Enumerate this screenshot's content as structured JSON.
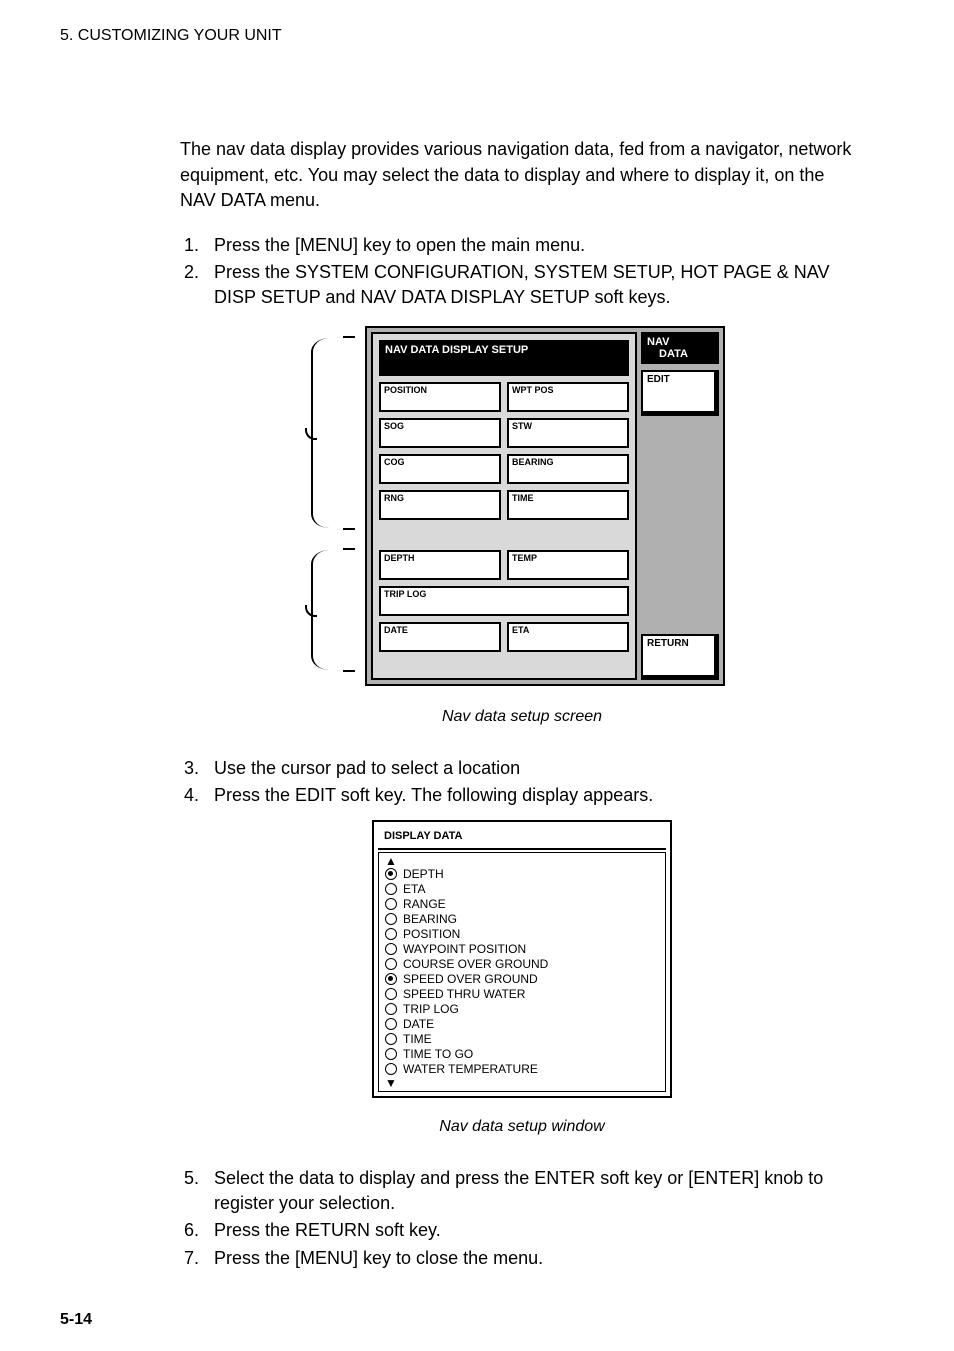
{
  "page": {
    "running_head": "5. CUSTOMIZING YOUR UNIT",
    "page_number": "5-14"
  },
  "intro": "The nav data display provides various navigation data, fed from a navigator, network equipment, etc. You may select the data to display and where to display it, on the NAV DATA menu.",
  "steps_1": [
    "Press the [MENU] key to open the main menu.",
    "Press the SYSTEM CONFIGURATION, SYSTEM SETUP, HOT PAGE & NAV DISP SETUP and NAV DATA DISPLAY SETUP soft keys."
  ],
  "fig1": {
    "side": {
      "title_l1": "NAV",
      "title_l2": "DATA",
      "btn1": "EDIT",
      "btn2": "RETURN"
    },
    "header": "NAV DATA DISPLAY SETUP",
    "cells_top": [
      [
        "POSITION",
        "WPT POS"
      ],
      [
        "SOG",
        "STW"
      ],
      [
        "COG",
        "BEARING"
      ],
      [
        "RNG",
        "TIME"
      ]
    ],
    "cells_bottom": [
      [
        "DEPTH",
        "TEMP"
      ],
      [
        "TRIP LOG",
        ""
      ],
      [
        "DATE",
        "ETA"
      ]
    ],
    "caption": "Nav data setup screen"
  },
  "steps_2": [
    "Use the cursor pad to select a location",
    "Press the EDIT soft key. The following display appears."
  ],
  "fig2": {
    "title": "DISPLAY DATA",
    "items": [
      {
        "label": "DEPTH",
        "sel": true
      },
      {
        "label": "ETA",
        "sel": false
      },
      {
        "label": "RANGE",
        "sel": false
      },
      {
        "label": "BEARING",
        "sel": false
      },
      {
        "label": "POSITION",
        "sel": false
      },
      {
        "label": "WAYPOINT POSITION",
        "sel": false
      },
      {
        "label": "COURSE OVER GROUND",
        "sel": false
      },
      {
        "label": "SPEED OVER GROUND",
        "sel": true
      },
      {
        "label": "SPEED THRU WATER",
        "sel": false
      },
      {
        "label": "TRIP LOG",
        "sel": false
      },
      {
        "label": "DATE",
        "sel": false
      },
      {
        "label": "TIME",
        "sel": false
      },
      {
        "label": "TIME TO GO",
        "sel": false
      },
      {
        "label": "WATER TEMPERATURE",
        "sel": false
      }
    ],
    "caption": "Nav data setup window"
  },
  "steps_3": [
    "Select the data to display and press the ENTER soft key or [ENTER] knob to register your selection.",
    "Press the RETURN soft key.",
    "Press the [MENU] key to close the menu."
  ]
}
